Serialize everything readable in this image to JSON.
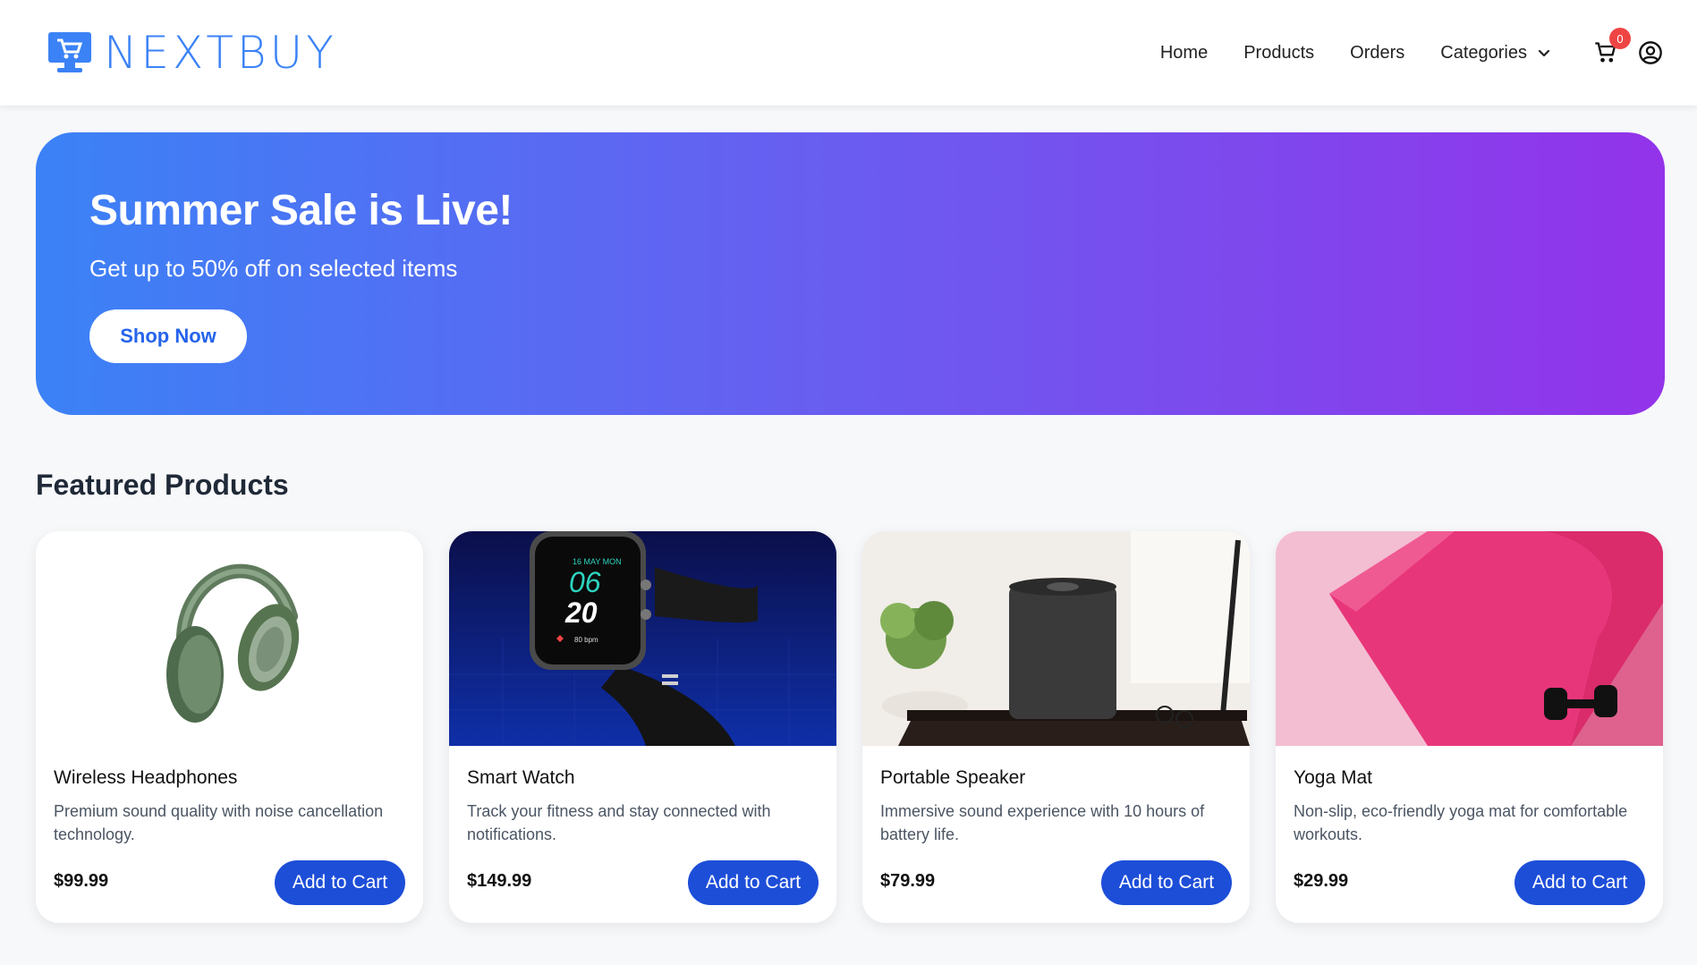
{
  "brand": {
    "name": "NEXTBUY",
    "logo_icon": "shopping-monitor-icon",
    "color": "#3b82f6"
  },
  "nav": {
    "links": [
      "Home",
      "Products",
      "Orders"
    ],
    "categories_label": "Categories",
    "cart_count": "0"
  },
  "hero": {
    "title": "Summer Sale is Live!",
    "subtitle": "Get up to 50% off on selected items",
    "button_label": "Shop Now",
    "gradient_start": "#3b82f6",
    "gradient_end": "#9333ea"
  },
  "featured": {
    "title": "Featured Products",
    "products": [
      {
        "name": "Wireless Headphones",
        "description": "Premium sound quality with noise cancellation technology.",
        "price": "$99.99",
        "button_label": "Add to Cart",
        "image_icon": "headphones-image"
      },
      {
        "name": "Smart Watch",
        "description": "Track your fitness and stay connected with notifications.",
        "price": "$149.99",
        "button_label": "Add to Cart",
        "image_icon": "smartwatch-image",
        "watch_date": "16 MAY MON",
        "watch_hour": "06",
        "watch_minute": "20",
        "watch_bpm": "80 bpm"
      },
      {
        "name": "Portable Speaker",
        "description": "Immersive sound experience with 10 hours of battery life.",
        "price": "$79.99",
        "button_label": "Add to Cart",
        "image_icon": "speaker-image"
      },
      {
        "name": "Yoga Mat",
        "description": "Non-slip, eco-friendly yoga mat for comfortable workouts.",
        "price": "$29.99",
        "button_label": "Add to Cart",
        "image_icon": "yoga-mat-image"
      }
    ]
  },
  "colors": {
    "button": "#1d4ed8",
    "badge": "#ef4444"
  }
}
